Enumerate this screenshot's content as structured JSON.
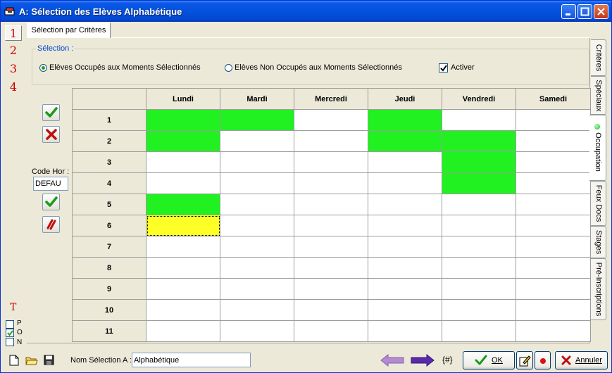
{
  "window": {
    "title": "A: Sélection des Elèves Alphabétique"
  },
  "left_strip": {
    "numbers": [
      "1",
      "2",
      "3",
      "4"
    ],
    "t_label": "T",
    "checks": [
      {
        "label": "P",
        "checked": false
      },
      {
        "label": "O",
        "checked": true
      },
      {
        "label": "N",
        "checked": false
      }
    ]
  },
  "tabs": {
    "top": "Sélection par Critères"
  },
  "selection": {
    "legend": "Sélection :",
    "option_occupied": "Elèves Occupés aux Moments Sélectionnés",
    "option_free": "Elèves Non Occupés aux Moments Sélectionnés",
    "activate_label": "Activer",
    "activate_checked": true,
    "selected_option": "occupied"
  },
  "side": {
    "code_label": "Code Hor :",
    "code_value": "DEFAU"
  },
  "grid": {
    "days": [
      "Lundi",
      "Mardi",
      "Mercredi",
      "Jeudi",
      "Vendredi",
      "Samedi"
    ],
    "periods": [
      "1",
      "2",
      "3",
      "4",
      "5",
      "6",
      "7",
      "8",
      "9",
      "10",
      "11"
    ],
    "occupied": [
      [
        1,
        1,
        0,
        1,
        0,
        0
      ],
      [
        1,
        0,
        0,
        1,
        1,
        0
      ],
      [
        0,
        0,
        0,
        0,
        1,
        0
      ],
      [
        0,
        0,
        0,
        0,
        1,
        0
      ],
      [
        1,
        0,
        0,
        0,
        0,
        0
      ],
      [
        2,
        0,
        0,
        0,
        0,
        0
      ],
      [
        0,
        0,
        0,
        0,
        0,
        0
      ],
      [
        0,
        0,
        0,
        0,
        0,
        0
      ],
      [
        0,
        0,
        0,
        0,
        0,
        0
      ],
      [
        0,
        0,
        0,
        0,
        0,
        0
      ],
      [
        0,
        0,
        0,
        0,
        0,
        0
      ]
    ],
    "colors": {
      "occupied": "#21f121",
      "current": "#ffff28"
    }
  },
  "right_tabs": [
    "Critères",
    "Spéciaux",
    "Occupation",
    "Feux Docs",
    "Stages",
    "Pré-Inscriptions"
  ],
  "bottom": {
    "nom_label": "Nom Sélection A :",
    "nom_value": "Alphabétique",
    "hash_label": "{#}",
    "ok_label": "OK",
    "cancel_label": "Annuler"
  }
}
